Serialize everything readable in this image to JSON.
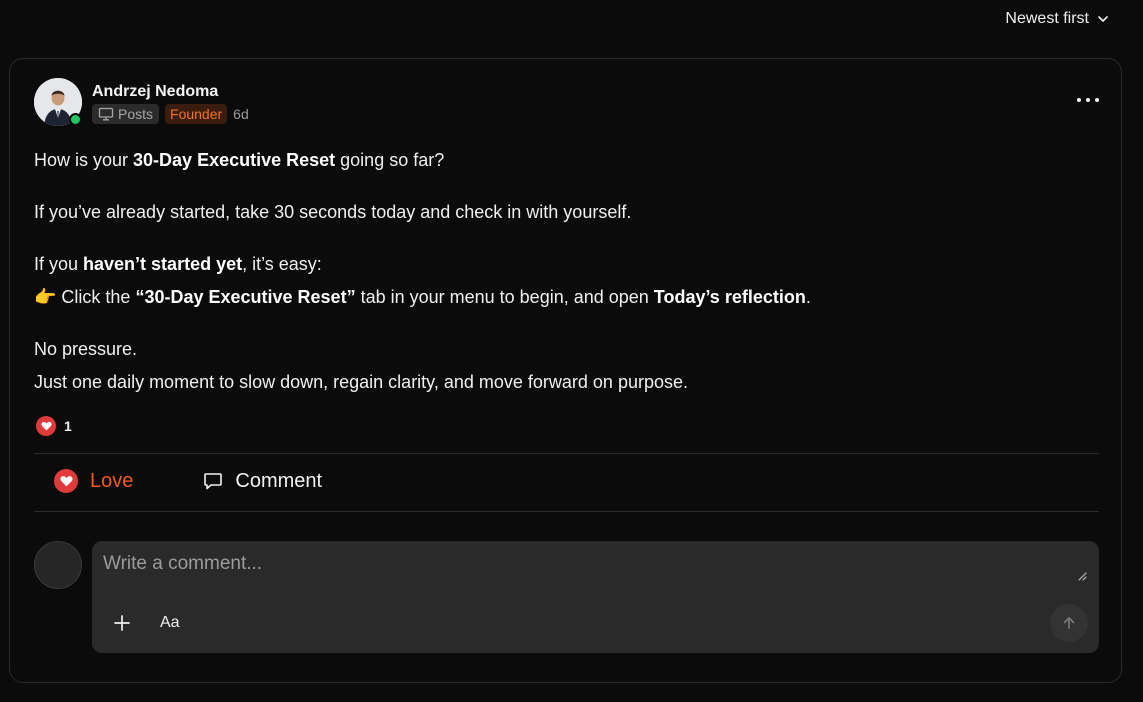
{
  "sort": {
    "label": "Newest first"
  },
  "post": {
    "author": "Andrzej Nedoma",
    "category_label": "Posts",
    "role_badge": "Founder",
    "age": "6d",
    "body": {
      "p1_a": "How is your ",
      "p1_b": "30-Day Executive Reset",
      "p1_c": " going so far?",
      "p2": "If you’ve already started, take 30 seconds today and check in with yourself.",
      "p3_a": "If you ",
      "p3_b": "haven’t started yet",
      "p3_c": ", it’s easy:",
      "p4_emoji": "👉",
      "p4_a": " Click the ",
      "p4_b": "“30-Day Executive Reset”",
      "p4_c": " tab in your menu to begin, and open ",
      "p4_d": "Today’s reflection",
      "p4_e": ".",
      "p5": "No pressure.",
      "p6": "Just one daily moment to slow down, regain clarity, and move forward on purpose."
    },
    "reaction_count": "1"
  },
  "actions": {
    "love_label": "Love",
    "comment_label": "Comment"
  },
  "comment_box": {
    "placeholder": "Write a comment...",
    "format_label": "Aa"
  },
  "colors": {
    "accent_orange": "#f05a1e",
    "heart_red": "#e03a3a",
    "online_green": "#22c55e",
    "background": "#0b0b0b"
  },
  "icons": {
    "sort": "chevron-down-icon",
    "category": "monitor-icon",
    "more": "more-horizontal-icon",
    "reaction": "heart-icon",
    "comment": "comment-bubble-icon",
    "attach": "plus-icon",
    "send": "arrow-up-icon"
  }
}
